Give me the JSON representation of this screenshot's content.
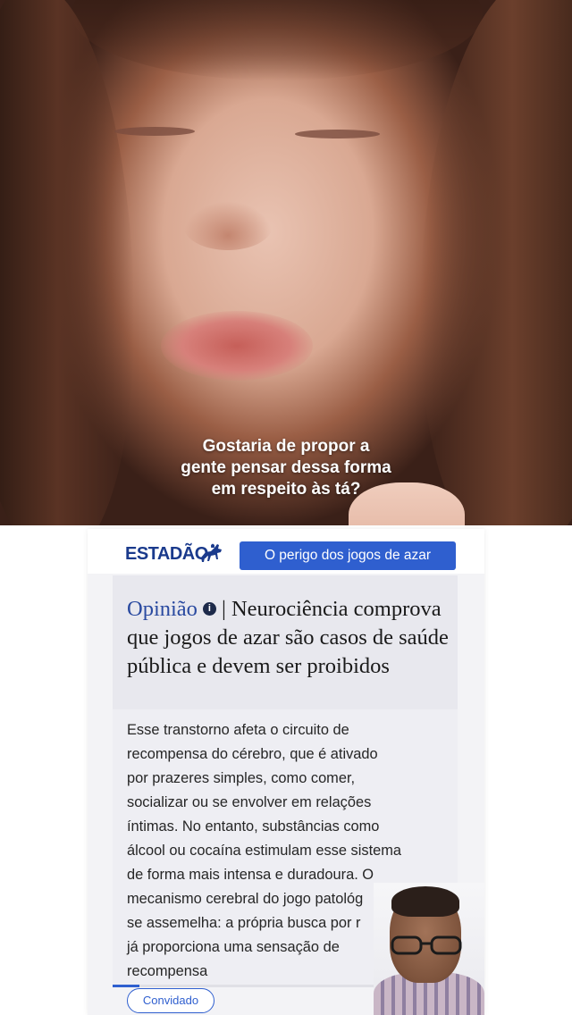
{
  "video": {
    "caption_lines": [
      "Gostaria de propor a",
      "gente pensar dessa forma",
      "em respeito às tá?"
    ]
  },
  "article": {
    "brand": "ESTADÃO",
    "topic": "O perigo dos jogos de azar",
    "kicker": "Opinião",
    "headline_rest": "Neurociência comprova que jogos de azar são casos de saúde pública e devem ser proibidos",
    "body_lines": [
      "Esse transtorno afeta o circuito de",
      "recompensa do cérebro, que é ativado",
      "por prazeres simples, como comer,",
      "socializar ou se envolver em relações",
      "íntimas. No entanto, substâncias como",
      "álcool ou cocaína estimulam esse sistema",
      "de forma mais intensa e duradoura. O",
      "mecanismo cerebral do jogo patológ",
      "se assemelha: a própria busca por r",
      "já proporciona uma sensação de",
      "recompensa"
    ],
    "tag": "Convidado"
  },
  "colors": {
    "brand_blue": "#1a3a8c",
    "pill_blue": "#2f5fcf",
    "kicker_blue": "#2a4aa0"
  },
  "icons": {
    "info": "info-icon",
    "logo": "horse-rider-logo-icon"
  }
}
